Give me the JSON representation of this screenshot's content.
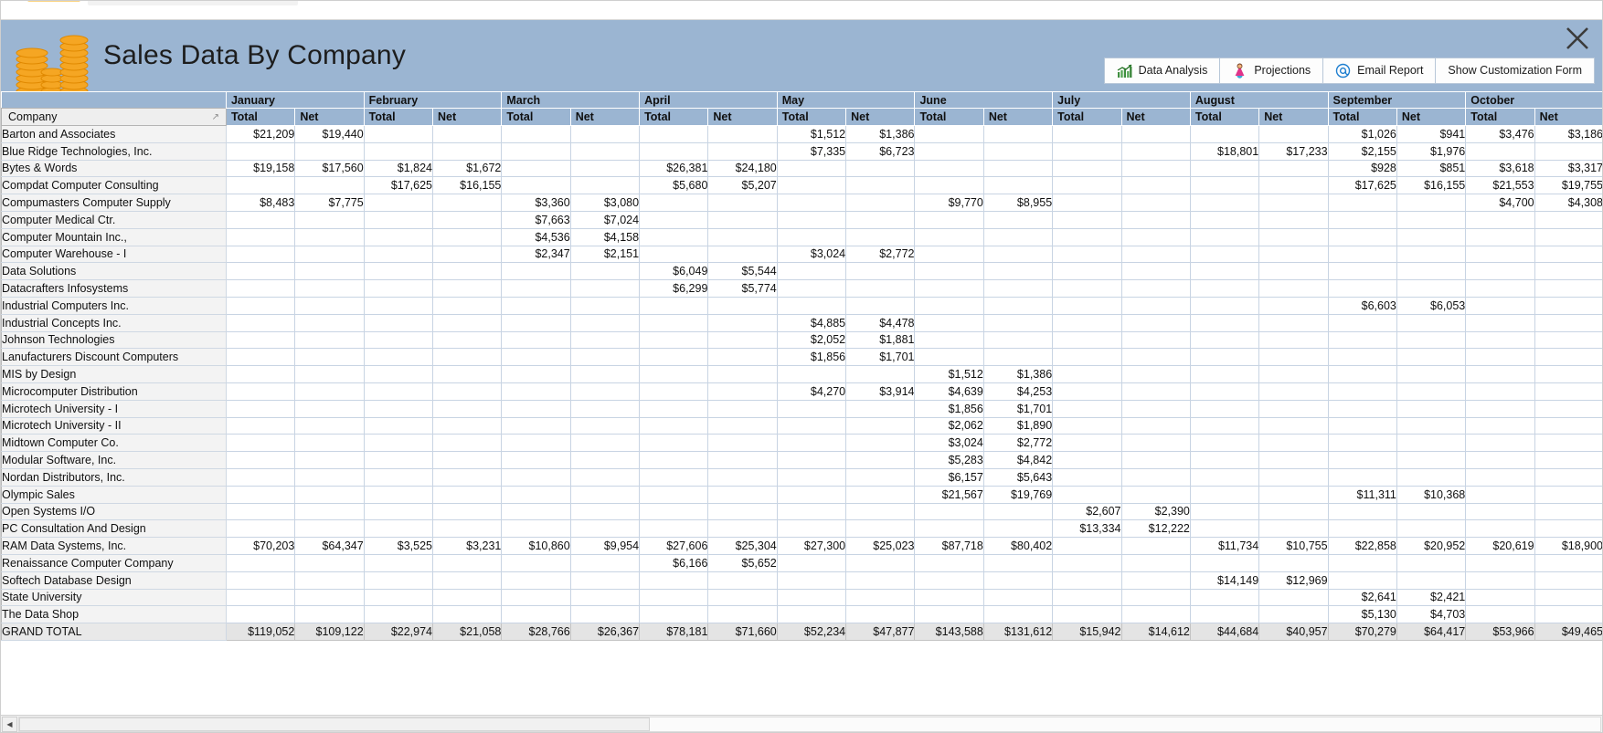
{
  "window": {
    "title": "Sales Data By Company",
    "close_label": "✕"
  },
  "toolbar": {
    "buttons": [
      {
        "label": "Data Analysis",
        "icon": "bar-chart-icon"
      },
      {
        "label": "Projections",
        "icon": "person-icon"
      },
      {
        "label": "Email Report",
        "icon": "at-sign-icon"
      },
      {
        "label": "Show Customization Form",
        "icon": "none"
      }
    ]
  },
  "grid": {
    "company_header": "Company",
    "sort_indicator": "↗",
    "months": [
      "January",
      "February",
      "March",
      "April",
      "May",
      "June",
      "July",
      "August",
      "September",
      "October"
    ],
    "sub_headers": [
      "Total",
      "Net"
    ],
    "grand_total_label": "GRAND TOTAL",
    "rows": [
      {
        "company": "Barton and Associates",
        "values": [
          "$21,209",
          "$19,440",
          "",
          "",
          "",
          "",
          "",
          "",
          "$1,512",
          "$1,386",
          "",
          "",
          "",
          "",
          "",
          "",
          "$1,026",
          "$941",
          "$3,476",
          "$3,186"
        ]
      },
      {
        "company": "Blue Ridge Technologies, Inc.",
        "values": [
          "",
          "",
          "",
          "",
          "",
          "",
          "",
          "",
          "$7,335",
          "$6,723",
          "",
          "",
          "",
          "",
          "$18,801",
          "$17,233",
          "$2,155",
          "$1,976",
          "",
          ""
        ]
      },
      {
        "company": "Bytes & Words",
        "values": [
          "$19,158",
          "$17,560",
          "$1,824",
          "$1,672",
          "",
          "",
          "$26,381",
          "$24,180",
          "",
          "",
          "",
          "",
          "",
          "",
          "",
          "",
          "$928",
          "$851",
          "$3,618",
          "$3,317"
        ]
      },
      {
        "company": "Compdat Computer Consulting",
        "values": [
          "",
          "",
          "$17,625",
          "$16,155",
          "",
          "",
          "$5,680",
          "$5,207",
          "",
          "",
          "",
          "",
          "",
          "",
          "",
          "",
          "$17,625",
          "$16,155",
          "$21,553",
          "$19,755"
        ]
      },
      {
        "company": "Compumasters Computer Supply",
        "values": [
          "$8,483",
          "$7,775",
          "",
          "",
          "$3,360",
          "$3,080",
          "",
          "",
          "",
          "",
          "$9,770",
          "$8,955",
          "",
          "",
          "",
          "",
          "",
          "",
          "$4,700",
          "$4,308"
        ]
      },
      {
        "company": "Computer Medical Ctr.",
        "values": [
          "",
          "",
          "",
          "",
          "$7,663",
          "$7,024",
          "",
          "",
          "",
          "",
          "",
          "",
          "",
          "",
          "",
          "",
          "",
          "",
          "",
          ""
        ]
      },
      {
        "company": "Computer Mountain Inc.,",
        "values": [
          "",
          "",
          "",
          "",
          "$4,536",
          "$4,158",
          "",
          "",
          "",
          "",
          "",
          "",
          "",
          "",
          "",
          "",
          "",
          "",
          "",
          ""
        ]
      },
      {
        "company": "Computer Warehouse - I",
        "values": [
          "",
          "",
          "",
          "",
          "$2,347",
          "$2,151",
          "",
          "",
          "$3,024",
          "$2,772",
          "",
          "",
          "",
          "",
          "",
          "",
          "",
          "",
          "",
          ""
        ]
      },
      {
        "company": "Data Solutions",
        "values": [
          "",
          "",
          "",
          "",
          "",
          "",
          "$6,049",
          "$5,544",
          "",
          "",
          "",
          "",
          "",
          "",
          "",
          "",
          "",
          "",
          "",
          ""
        ]
      },
      {
        "company": "Datacrafters Infosystems",
        "values": [
          "",
          "",
          "",
          "",
          "",
          "",
          "$6,299",
          "$5,774",
          "",
          "",
          "",
          "",
          "",
          "",
          "",
          "",
          "",
          "",
          "",
          ""
        ]
      },
      {
        "company": "Industrial Computers Inc.",
        "values": [
          "",
          "",
          "",
          "",
          "",
          "",
          "",
          "",
          "",
          "",
          "",
          "",
          "",
          "",
          "",
          "",
          "$6,603",
          "$6,053",
          "",
          ""
        ]
      },
      {
        "company": "Industrial Concepts Inc.",
        "values": [
          "",
          "",
          "",
          "",
          "",
          "",
          "",
          "",
          "$4,885",
          "$4,478",
          "",
          "",
          "",
          "",
          "",
          "",
          "",
          "",
          "",
          ""
        ]
      },
      {
        "company": "Johnson Technologies",
        "values": [
          "",
          "",
          "",
          "",
          "",
          "",
          "",
          "",
          "$2,052",
          "$1,881",
          "",
          "",
          "",
          "",
          "",
          "",
          "",
          "",
          "",
          ""
        ]
      },
      {
        "company": "Lanufacturers Discount Computers",
        "values": [
          "",
          "",
          "",
          "",
          "",
          "",
          "",
          "",
          "$1,856",
          "$1,701",
          "",
          "",
          "",
          "",
          "",
          "",
          "",
          "",
          "",
          ""
        ]
      },
      {
        "company": "MIS by Design",
        "values": [
          "",
          "",
          "",
          "",
          "",
          "",
          "",
          "",
          "",
          "",
          "$1,512",
          "$1,386",
          "",
          "",
          "",
          "",
          "",
          "",
          "",
          ""
        ]
      },
      {
        "company": "Microcomputer Distribution",
        "values": [
          "",
          "",
          "",
          "",
          "",
          "",
          "",
          "",
          "$4,270",
          "$3,914",
          "$4,639",
          "$4,253",
          "",
          "",
          "",
          "",
          "",
          "",
          "",
          ""
        ]
      },
      {
        "company": "Microtech University - I",
        "values": [
          "",
          "",
          "",
          "",
          "",
          "",
          "",
          "",
          "",
          "",
          "$1,856",
          "$1,701",
          "",
          "",
          "",
          "",
          "",
          "",
          "",
          ""
        ]
      },
      {
        "company": "Microtech University - II",
        "values": [
          "",
          "",
          "",
          "",
          "",
          "",
          "",
          "",
          "",
          "",
          "$2,062",
          "$1,890",
          "",
          "",
          "",
          "",
          "",
          "",
          "",
          ""
        ]
      },
      {
        "company": "Midtown Computer Co.",
        "values": [
          "",
          "",
          "",
          "",
          "",
          "",
          "",
          "",
          "",
          "",
          "$3,024",
          "$2,772",
          "",
          "",
          "",
          "",
          "",
          "",
          "",
          ""
        ]
      },
      {
        "company": "Modular Software, Inc.",
        "values": [
          "",
          "",
          "",
          "",
          "",
          "",
          "",
          "",
          "",
          "",
          "$5,283",
          "$4,842",
          "",
          "",
          "",
          "",
          "",
          "",
          "",
          ""
        ]
      },
      {
        "company": "Nordan Distributors, Inc.",
        "values": [
          "",
          "",
          "",
          "",
          "",
          "",
          "",
          "",
          "",
          "",
          "$6,157",
          "$5,643",
          "",
          "",
          "",
          "",
          "",
          "",
          "",
          ""
        ]
      },
      {
        "company": "Olympic Sales",
        "values": [
          "",
          "",
          "",
          "",
          "",
          "",
          "",
          "",
          "",
          "",
          "$21,567",
          "$19,769",
          "",
          "",
          "",
          "",
          "$11,311",
          "$10,368",
          "",
          ""
        ]
      },
      {
        "company": "Open Systems I/O",
        "values": [
          "",
          "",
          "",
          "",
          "",
          "",
          "",
          "",
          "",
          "",
          "",
          "",
          "$2,607",
          "$2,390",
          "",
          "",
          "",
          "",
          "",
          ""
        ]
      },
      {
        "company": "PC Consultation And Design",
        "values": [
          "",
          "",
          "",
          "",
          "",
          "",
          "",
          "",
          "",
          "",
          "",
          "",
          "$13,334",
          "$12,222",
          "",
          "",
          "",
          "",
          "",
          ""
        ]
      },
      {
        "company": "RAM Data Systems, Inc.",
        "values": [
          "$70,203",
          "$64,347",
          "$3,525",
          "$3,231",
          "$10,860",
          "$9,954",
          "$27,606",
          "$25,304",
          "$27,300",
          "$25,023",
          "$87,718",
          "$80,402",
          "",
          "",
          "$11,734",
          "$10,755",
          "$22,858",
          "$20,952",
          "$20,619",
          "$18,900"
        ]
      },
      {
        "company": "Renaissance Computer Company",
        "values": [
          "",
          "",
          "",
          "",
          "",
          "",
          "$6,166",
          "$5,652",
          "",
          "",
          "",
          "",
          "",
          "",
          "",
          "",
          "",
          "",
          "",
          ""
        ]
      },
      {
        "company": "Softech Database Design",
        "values": [
          "",
          "",
          "",
          "",
          "",
          "",
          "",
          "",
          "",
          "",
          "",
          "",
          "",
          "",
          "$14,149",
          "$12,969",
          "",
          "",
          "",
          ""
        ]
      },
      {
        "company": "State University",
        "values": [
          "",
          "",
          "",
          "",
          "",
          "",
          "",
          "",
          "",
          "",
          "",
          "",
          "",
          "",
          "",
          "",
          "$2,641",
          "$2,421",
          "",
          ""
        ]
      },
      {
        "company": "The Data Shop",
        "values": [
          "",
          "",
          "",
          "",
          "",
          "",
          "",
          "",
          "",
          "",
          "",
          "",
          "",
          "",
          "",
          "",
          "$5,130",
          "$4,703",
          "",
          ""
        ]
      }
    ],
    "grand_total_values": [
      "$119,052",
      "$109,122",
      "$22,974",
      "$21,058",
      "$28,766",
      "$26,367",
      "$78,181",
      "$71,660",
      "$52,234",
      "$47,877",
      "$143,588",
      "$131,612",
      "$15,942",
      "$14,612",
      "$44,684",
      "$40,957",
      "$70,279",
      "$64,417",
      "$53,966",
      "$49,465"
    ]
  },
  "scrollbar": {
    "left_arrow": "◀"
  },
  "colors": {
    "header_band": "#9bb5d2",
    "row_label_bg": "#f3f3f3",
    "grid_line": "#c8d4e3",
    "total_row_bg": "#e4e4e4"
  }
}
